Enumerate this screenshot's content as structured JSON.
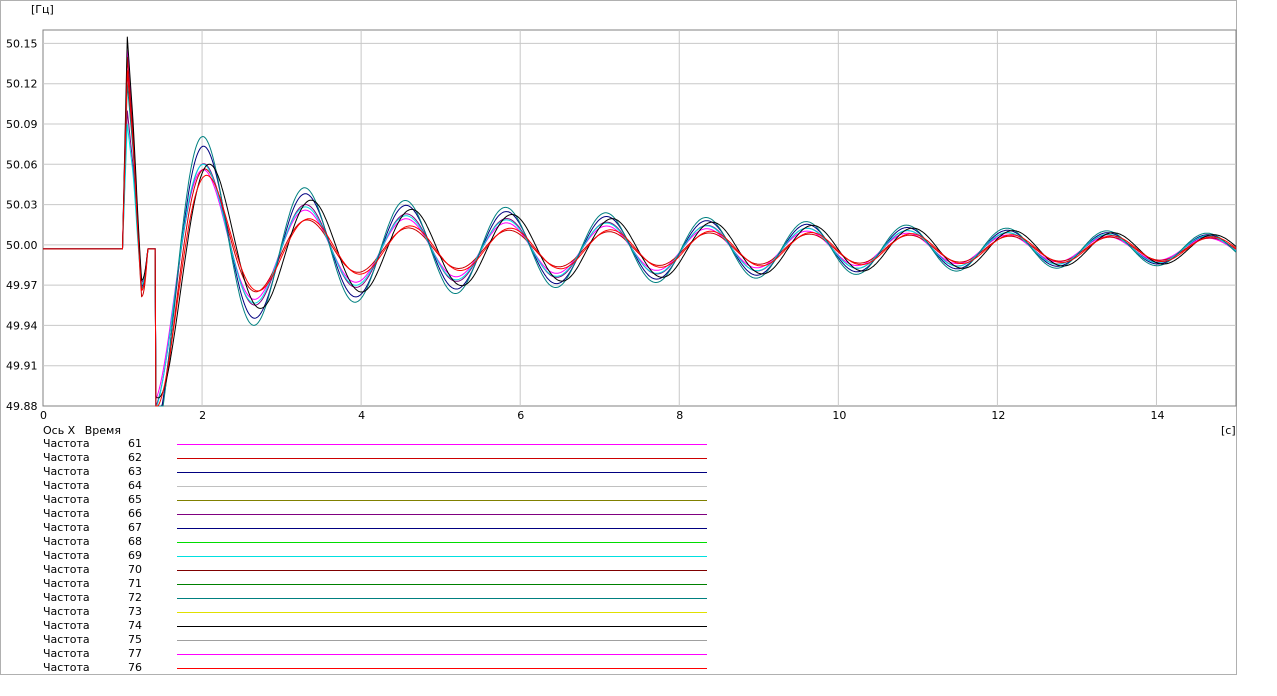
{
  "chart_data": {
    "type": "line",
    "ylabel": "[Гц]",
    "xlabel": "[с]",
    "xaxis_caption": {
      "label": "Ось X",
      "name": "Время"
    },
    "xlim": [
      0,
      15
    ],
    "ylim": [
      49.88,
      50.16
    ],
    "x_ticks": [
      0,
      2,
      4,
      6,
      8,
      10,
      12,
      14
    ],
    "y_ticks": [
      "49.88",
      "49.91",
      "49.94",
      "49.97",
      "50.00",
      "50.03",
      "50.06",
      "50.09",
      "50.12",
      "50.15"
    ],
    "grid": true,
    "steady_value": 49.997,
    "disturbance_time": 1.0,
    "oscillation_period_s": 1.26,
    "series": [
      {
        "label": "Частота",
        "id": "61",
        "color": "#ff00ff",
        "peak": 50.145,
        "dip": 49.915,
        "amp1": 0.03,
        "decay": 0.1,
        "phase_shift": 0.0
      },
      {
        "label": "Частота",
        "id": "62",
        "color": "#cc0000",
        "peak": 50.14,
        "dip": 49.88,
        "amp1": 0.018,
        "decay": 0.06,
        "phase_shift": 0.15
      },
      {
        "label": "Частота",
        "id": "63",
        "color": "#000080",
        "peak": 50.13,
        "dip": 49.905,
        "amp1": 0.045,
        "decay": 0.11,
        "phase_shift": 0.0
      },
      {
        "label": "Частота",
        "id": "64",
        "color": "#c0c0c0",
        "hidden": true
      },
      {
        "label": "Частота",
        "id": "65",
        "color": "#808000",
        "hidden": true
      },
      {
        "label": "Частота",
        "id": "66",
        "color": "#800080",
        "peak": 50.1,
        "dip": 49.915,
        "amp1": 0.035,
        "decay": 0.1,
        "phase_shift": 0.02
      },
      {
        "label": "Частота",
        "id": "67",
        "color": "#000080",
        "hidden": true
      },
      {
        "label": "Частота",
        "id": "68",
        "color": "#00dd00",
        "hidden": true
      },
      {
        "label": "Частота",
        "id": "69",
        "color": "#00e0e0",
        "peak": 50.09,
        "dip": 49.91,
        "amp1": 0.032,
        "decay": 0.09,
        "phase_shift": 0.0
      },
      {
        "label": "Частота",
        "id": "70",
        "color": "#800000",
        "hidden": true
      },
      {
        "label": "Частота",
        "id": "71",
        "color": "#008000",
        "hidden": true
      },
      {
        "label": "Частота",
        "id": "72",
        "color": "#008080",
        "peak": 50.12,
        "dip": 49.9,
        "amp1": 0.05,
        "decay": 0.11,
        "phase_shift": -0.05
      },
      {
        "label": "Частота",
        "id": "73",
        "color": "#e0e000",
        "hidden": true
      },
      {
        "label": "Частота",
        "id": "74",
        "color": "#000000",
        "peak": 50.155,
        "dip": 49.92,
        "amp1": 0.04,
        "decay": 0.1,
        "phase_shift": 0.35
      },
      {
        "label": "Частота",
        "id": "75",
        "color": "#a0a0a0",
        "hidden": true
      },
      {
        "label": "Частота",
        "id": "77",
        "color": "#ff00ff",
        "hidden": true
      },
      {
        "label": "Частота",
        "id": "76",
        "color": "#ff0000",
        "peak": 50.13,
        "dip": 49.895,
        "amp1": 0.02,
        "decay": 0.06,
        "phase_shift": 0.25
      }
    ]
  }
}
